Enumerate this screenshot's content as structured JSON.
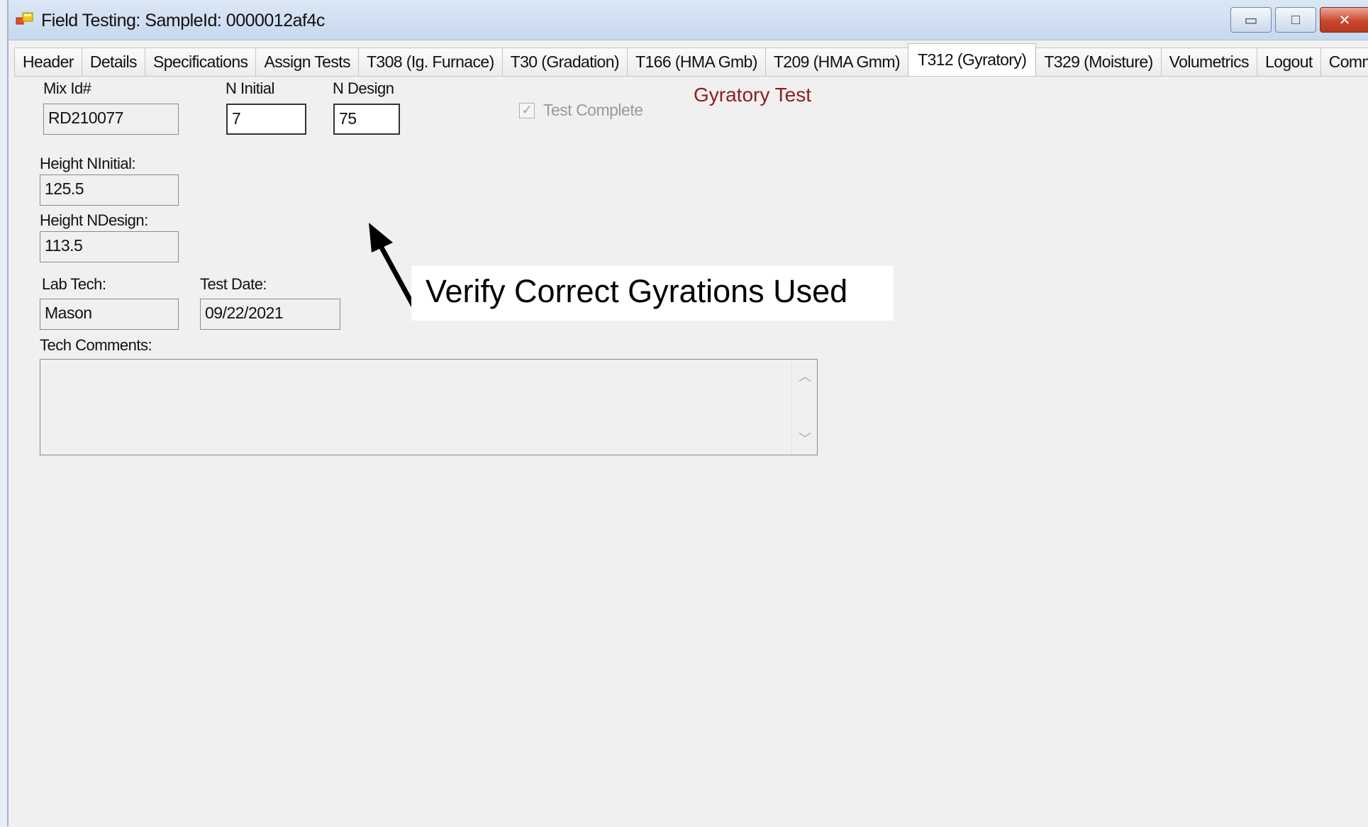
{
  "window": {
    "title": "Field Testing: SampleId: 0000012af4c",
    "controls": {
      "minimize": "▭",
      "maximize": "□",
      "close": "✕"
    }
  },
  "tabs": [
    {
      "label": "Header"
    },
    {
      "label": "Details"
    },
    {
      "label": "Specifications"
    },
    {
      "label": "Assign Tests"
    },
    {
      "label": "T308 (Ig. Furnace)"
    },
    {
      "label": "T30 (Gradation)"
    },
    {
      "label": "T166 (HMA Gmb)"
    },
    {
      "label": "T209 (HMA Gmm)"
    },
    {
      "label": "T312 (Gyratory)"
    },
    {
      "label": "T329 (Moisture)"
    },
    {
      "label": "Volumetrics"
    },
    {
      "label": "Logout"
    },
    {
      "label": "Comments"
    }
  ],
  "active_tab": "T312 (Gyratory)",
  "form": {
    "section_title": "Gyratory Test",
    "mix_id": {
      "label": "Mix Id#",
      "value": "RD210077"
    },
    "n_initial": {
      "label": "N Initial",
      "value": "7"
    },
    "n_design": {
      "label": "N Design",
      "value": "75"
    },
    "test_complete": {
      "label": "Test Complete",
      "checked": true
    },
    "height_ninitial": {
      "label": "Height NInitial:",
      "value": "125.5"
    },
    "height_ndesign": {
      "label": "Height NDesign:",
      "value": "113.5"
    },
    "lab_tech": {
      "label": "Lab Tech:",
      "value": "Mason"
    },
    "test_date": {
      "label": "Test Date:",
      "value": "09/22/2021"
    },
    "tech_comments": {
      "label": "Tech Comments:",
      "value": ""
    }
  },
  "annotation": {
    "callout_text": "Verify Correct Gyrations Used"
  },
  "colors": {
    "section_title": "#8b1e1e",
    "window_bg": "#f0f0f0",
    "titlebar": "#c7d8ee"
  }
}
